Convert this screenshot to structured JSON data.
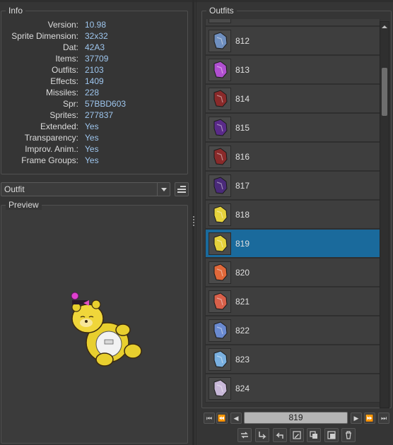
{
  "info": {
    "title": "Info",
    "rows": [
      {
        "label": "Version:",
        "value": "10.98"
      },
      {
        "label": "Sprite Dimension:",
        "value": "32x32"
      },
      {
        "label": "Dat:",
        "value": "42A3"
      },
      {
        "label": "Items:",
        "value": "37709"
      },
      {
        "label": "Outfits:",
        "value": "2103"
      },
      {
        "label": "Effects:",
        "value": "1409"
      },
      {
        "label": "Missiles:",
        "value": "228"
      },
      {
        "label": "Spr:",
        "value": "57BBD603"
      },
      {
        "label": "Sprites:",
        "value": "277837"
      },
      {
        "label": "Extended:",
        "value": "Yes"
      },
      {
        "label": "Transparency:",
        "value": "Yes"
      },
      {
        "label": "Improv. Anim.:",
        "value": "Yes"
      },
      {
        "label": "Frame Groups:",
        "value": "Yes"
      }
    ]
  },
  "type_selector": {
    "value": "Outfit",
    "icon": "chevron-down-icon"
  },
  "list_mode_icon": "list-icon",
  "preview": {
    "title": "Preview"
  },
  "outfits": {
    "title": "Outfits",
    "items": [
      {
        "id": "812",
        "color": "#6f8fbf"
      },
      {
        "id": "813",
        "color": "#b04fd0"
      },
      {
        "id": "814",
        "color": "#8a2a2a"
      },
      {
        "id": "815",
        "color": "#5a2a8a"
      },
      {
        "id": "816",
        "color": "#8a2a2a"
      },
      {
        "id": "817",
        "color": "#4a2a7a"
      },
      {
        "id": "818",
        "color": "#e6d23c"
      },
      {
        "id": "819",
        "color": "#e6d23c"
      },
      {
        "id": "820",
        "color": "#e0683a"
      },
      {
        "id": "821",
        "color": "#d8604a"
      },
      {
        "id": "822",
        "color": "#6a8ad0"
      },
      {
        "id": "823",
        "color": "#7ab0e0"
      },
      {
        "id": "824",
        "color": "#c8b8d8"
      }
    ],
    "selected_id": "819",
    "selection_color": "#1a6a9c"
  },
  "pagination": {
    "current": "819",
    "first_icon": "first-page-icon",
    "prev_page_icon": "previous-page-icon",
    "prev_icon": "previous-icon",
    "next_icon": "next-icon",
    "next_page_icon": "next-page-icon",
    "last_icon": "last-page-icon"
  },
  "toolbar": {
    "icons": [
      "replace-icon",
      "export-icon",
      "undo-icon",
      "edit-icon",
      "duplicate-icon",
      "new-icon",
      "delete-icon"
    ]
  }
}
